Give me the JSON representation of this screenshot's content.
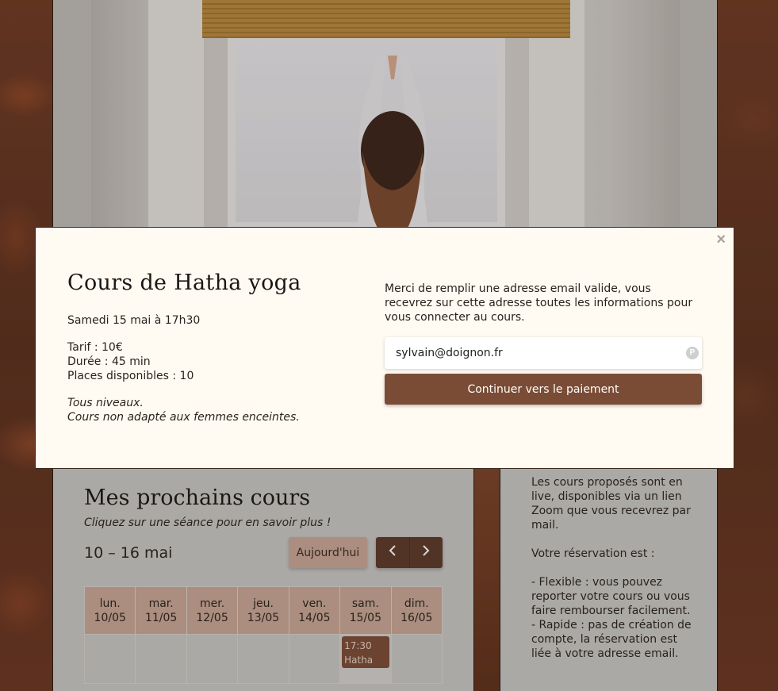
{
  "modal": {
    "close_label": "×",
    "title": "Cours de Hatha yoga",
    "date": "Samedi 15 mai à 17h30",
    "details": [
      "Tarif : 10€",
      "Durée : 45 min",
      "Places disponibles : 10"
    ],
    "notes": [
      "Tous niveaux.",
      "Cours non adapté aux femmes enceintes."
    ],
    "info": "Merci de remplir une adresse email valide, vous recevrez sur cette adresse toutes les informations pour vous connecter au cours.",
    "email_value": "sylvain@doignon.fr",
    "pay_button": "Continuer vers le paiement"
  },
  "schedule": {
    "title": "Mes prochains cours",
    "subtitle": "Cliquez sur une séance pour en savoir plus !",
    "range": "10 – 16 mai",
    "today_button": "Aujourd'hui",
    "prev_icon": "chevron-left-icon",
    "next_icon": "chevron-right-icon",
    "days": [
      {
        "day": "lun.",
        "date": "10/05"
      },
      {
        "day": "mar.",
        "date": "11/05"
      },
      {
        "day": "mer.",
        "date": "12/05"
      },
      {
        "day": "jeu.",
        "date": "13/05"
      },
      {
        "day": "ven.",
        "date": "14/05"
      },
      {
        "day": "sam.",
        "date": "15/05"
      },
      {
        "day": "dim.",
        "date": "16/05"
      }
    ],
    "event": {
      "time": "17:30",
      "name": "Hatha"
    }
  },
  "sidebar": {
    "text": "Les cours proposés sont en live, disponibles via un lien Zoom que vous recevrez par mail.\n\nVotre réservation est :\n\n- Flexible : vous pouvez reporter votre cours ou vous faire rembourser facilement.\n- Rapide : pas de création de compte, la réservation est liée à votre adresse email."
  },
  "colors": {
    "accent": "#7a4c35",
    "header_cell": "#c8a895",
    "modal_bg": "#fffbf3"
  }
}
